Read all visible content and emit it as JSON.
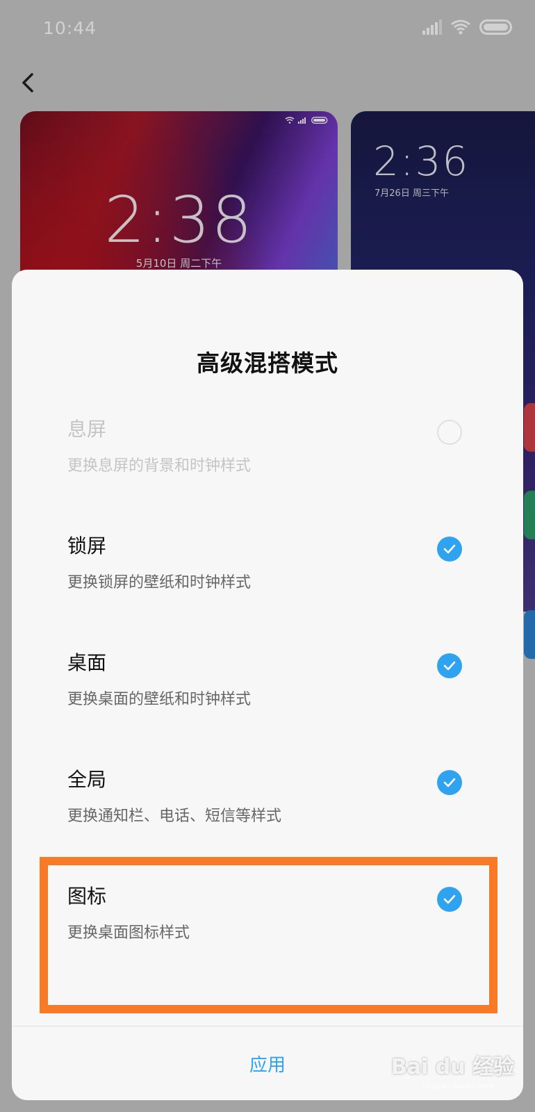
{
  "status_bar": {
    "time": "10:44"
  },
  "preview_cards": [
    {
      "clock": "2:38",
      "date": "5月10日  周二下午"
    },
    {
      "clock": "2:36",
      "date": "7月26日  周三下午"
    }
  ],
  "sheet": {
    "title": "高级混搭模式",
    "options": [
      {
        "title": "息屏",
        "desc": "更换息屏的背景和时钟样式",
        "checked": false,
        "enabled": false
      },
      {
        "title": "锁屏",
        "desc": "更换锁屏的壁纸和时钟样式",
        "checked": true,
        "enabled": true
      },
      {
        "title": "桌面",
        "desc": "更换桌面的壁纸和时钟样式",
        "checked": true,
        "enabled": true
      },
      {
        "title": "全局",
        "desc": "更换通知栏、电话、短信等样式",
        "checked": true,
        "enabled": true
      },
      {
        "title": "图标",
        "desc": "更换桌面图标样式",
        "checked": true,
        "enabled": true
      }
    ],
    "apply_label": "应用"
  },
  "colors": {
    "accent": "#2fa3ef",
    "highlight": "#f97a26"
  },
  "watermark": {
    "brand": "Bai du 经验",
    "url": "jingyan.baidu.com"
  },
  "icons": [
    "signal-icon",
    "wifi-icon",
    "battery-icon",
    "back-arrow-icon",
    "check-icon"
  ]
}
